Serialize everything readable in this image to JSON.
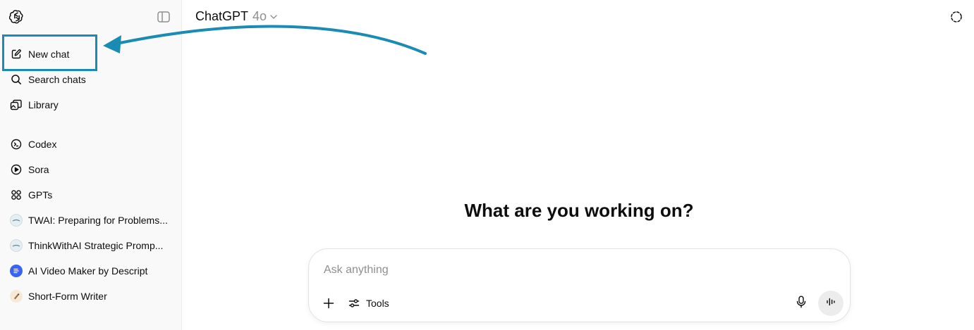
{
  "sidebar": {
    "top_nav": [
      {
        "label": "New chat",
        "icon": "new-chat-icon"
      },
      {
        "label": "Search chats",
        "icon": "search-icon"
      },
      {
        "label": "Library",
        "icon": "library-icon"
      }
    ],
    "apps": [
      {
        "label": "Codex",
        "icon": "codex-icon"
      },
      {
        "label": "Sora",
        "icon": "sora-icon"
      },
      {
        "label": "GPTs",
        "icon": "gpts-icon"
      }
    ],
    "gpts": [
      {
        "label": "TWAI: Preparing for Problems...",
        "icon": "twai-avatar"
      },
      {
        "label": "ThinkWithAI Strategic Promp...",
        "icon": "thinkwithai-avatar"
      },
      {
        "label": "AI Video Maker by Descript",
        "icon": "descript-avatar"
      },
      {
        "label": "Short-Form Writer",
        "icon": "short-form-writer-avatar"
      }
    ]
  },
  "header": {
    "title": "ChatGPT",
    "model": "4o"
  },
  "main": {
    "headline": "What are you working on?",
    "composer": {
      "placeholder": "Ask anything",
      "tools_label": "Tools"
    }
  },
  "annotation": {
    "highlight_color": "#1a8cb4"
  }
}
